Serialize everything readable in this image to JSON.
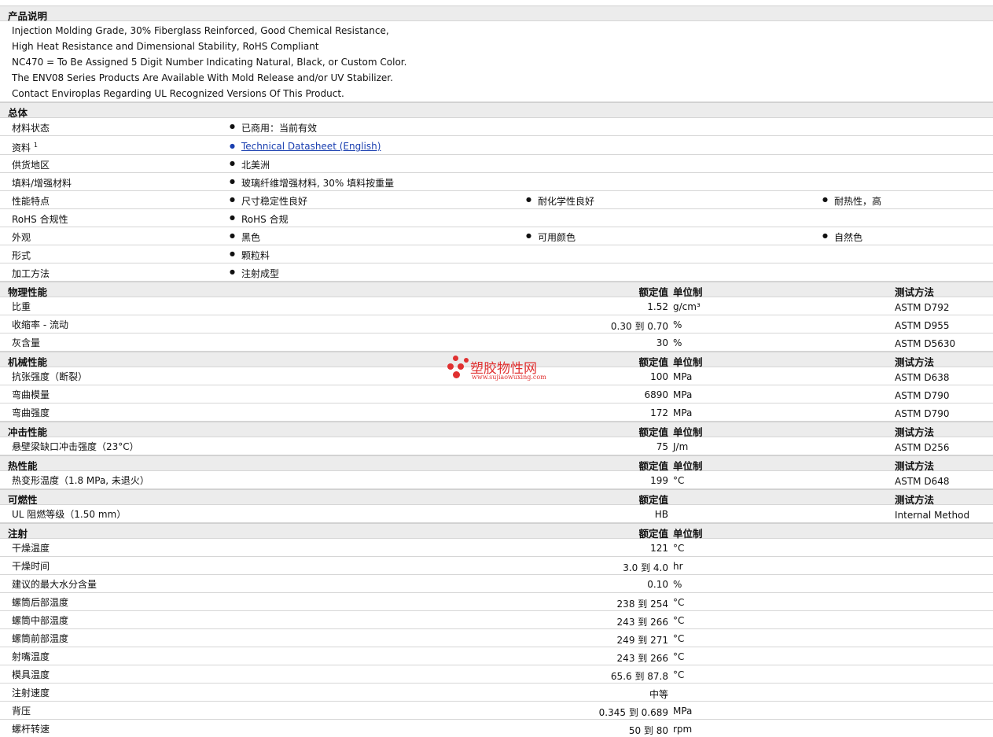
{
  "description": {
    "title": "产品说明",
    "lines": [
      "Injection Molding Grade, 30% Fiberglass Reinforced, Good Chemical Resistance,",
      "High Heat Resistance and Dimensional Stability, RoHS Compliant",
      "NC470 = To Be Assigned 5 Digit Number Indicating Natural, Black, or Custom Color.",
      "The ENV08 Series Products Are Available With Mold Release and/or UV Stabilizer.",
      "Contact Enviroplas Regarding UL Recognized Versions Of This Product."
    ]
  },
  "general": {
    "title": "总体",
    "rows": [
      {
        "label": "材料状态",
        "values": [
          "已商用：当前有效"
        ]
      },
      {
        "label": "资料",
        "sup": "1",
        "values": [
          "Technical Datasheet (English)"
        ],
        "link": true
      },
      {
        "label": "供货地区",
        "values": [
          "北美洲"
        ]
      },
      {
        "label": "填料/增强材料",
        "values": [
          "玻璃纤维增强材料, 30% 填料按重量"
        ]
      },
      {
        "label": "性能特点",
        "values": [
          "尺寸稳定性良好",
          "耐化学性良好",
          "耐热性，高"
        ]
      },
      {
        "label": "RoHS 合规性",
        "values": [
          "RoHS 合规"
        ]
      },
      {
        "label": "外观",
        "values": [
          "黑色",
          "可用颜色",
          "自然色"
        ]
      },
      {
        "label": "形式",
        "values": [
          "颗粒料"
        ]
      },
      {
        "label": "加工方法",
        "values": [
          "注射成型"
        ]
      }
    ]
  },
  "headers": {
    "nominal": "额定值",
    "unit": "单位制",
    "method": "测试方法"
  },
  "physical": {
    "title": "物理性能",
    "rows": [
      {
        "label": "比重",
        "value": "1.52",
        "unit": "g/cm³",
        "method": "ASTM D792"
      },
      {
        "label": "收缩率 - 流动",
        "value": "0.30 到  0.70",
        "unit": "%",
        "method": "ASTM D955"
      },
      {
        "label": "灰含量",
        "value": "30",
        "unit": "%",
        "method": "ASTM D5630"
      }
    ]
  },
  "mechanical": {
    "title": "机械性能",
    "rows": [
      {
        "label": "抗张强度（断裂）",
        "value": "100",
        "unit": "MPa",
        "method": "ASTM D638"
      },
      {
        "label": "弯曲模量",
        "value": "6890",
        "unit": "MPa",
        "method": "ASTM D790"
      },
      {
        "label": "弯曲强度",
        "value": "172",
        "unit": "MPa",
        "method": "ASTM D790"
      }
    ]
  },
  "impact": {
    "title": "冲击性能",
    "rows": [
      {
        "label": "悬壁梁缺口冲击强度（23°C）",
        "value": "75",
        "unit": "J/m",
        "method": "ASTM D256"
      }
    ]
  },
  "thermal": {
    "title": "热性能",
    "rows": [
      {
        "label": "热变形温度（1.8 MPa, 未退火）",
        "value": "199",
        "unit": "°C",
        "method": "ASTM D648"
      }
    ]
  },
  "flammability": {
    "title": "可燃性",
    "rows": [
      {
        "label": "UL 阻燃等级（1.50 mm）",
        "value": "HB",
        "unit": "",
        "method": "Internal Method"
      }
    ]
  },
  "injection": {
    "title": "注射",
    "rows": [
      {
        "label": "干燥温度",
        "value": "121",
        "unit": "°C"
      },
      {
        "label": "干燥时间",
        "value": "3.0 到  4.0",
        "unit": "hr"
      },
      {
        "label": "建议的最大水分含量",
        "value": "0.10",
        "unit": "%"
      },
      {
        "label": "螺筒后部温度",
        "value": "238 到  254",
        "unit": "°C"
      },
      {
        "label": "螺筒中部温度",
        "value": "243 到  266",
        "unit": "°C"
      },
      {
        "label": "螺筒前部温度",
        "value": "249 到  271",
        "unit": "°C"
      },
      {
        "label": "射嘴温度",
        "value": "243 到  266",
        "unit": "°C"
      },
      {
        "label": "模具温度",
        "value": "65.6 到  87.8",
        "unit": "°C"
      },
      {
        "label": "注射速度",
        "value": "中等",
        "unit": ""
      },
      {
        "label": "背压",
        "value": "0.345 到  0.689",
        "unit": "MPa"
      },
      {
        "label": "螺杆转速",
        "value": "50 到  80",
        "unit": "rpm"
      }
    ]
  },
  "watermark": {
    "name": "塑胶物性网",
    "url": "www.sujiaowuxing.com",
    "color": "#e03030"
  }
}
